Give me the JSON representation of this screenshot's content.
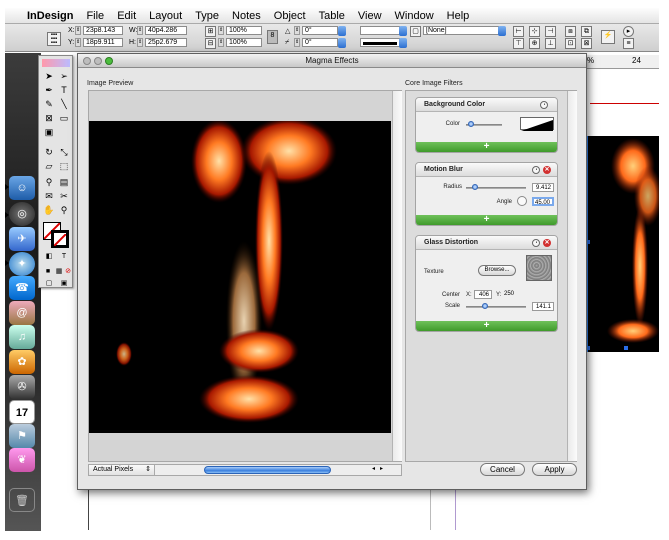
{
  "menu": {
    "app": "InDesign",
    "items": [
      "File",
      "Edit",
      "Layout",
      "Type",
      "Notes",
      "Object",
      "Table",
      "View",
      "Window",
      "Help"
    ]
  },
  "control": {
    "x": "23p8.143",
    "y": "18p9.911",
    "w": "40p4.286",
    "h": "25p2.679",
    "x_label": "X:",
    "y_label": "Y:",
    "w_label": "W:",
    "h_label": "H:",
    "scale_x": "100%",
    "scale_y": "100%",
    "rotate": "0°",
    "shear": "0°",
    "style": "[None]"
  },
  "ruler": {
    "percent": "%",
    "tick_24": "24"
  },
  "dialog": {
    "title": "Magma Effects",
    "preview_label": "Image Preview",
    "filters_label": "Core Image Filters",
    "zoom": "Actual Pixels",
    "cancel": "Cancel",
    "apply": "Apply"
  },
  "filters": [
    {
      "name": "Background Color",
      "params": [
        {
          "label": "Color"
        }
      ]
    },
    {
      "name": "Motion Blur",
      "params": [
        {
          "label": "Radius",
          "value": "9.412"
        },
        {
          "label": "Angle",
          "value": "45.00"
        }
      ]
    },
    {
      "name": "Glass Distortion",
      "texture_label": "Texture",
      "browse": "Browse...",
      "center_label": "Center",
      "center_x_label": "X:",
      "center_x": "406",
      "center_y_label": "Y:",
      "center_y": "250",
      "scale_label": "Scale",
      "scale": "141.1"
    }
  ],
  "add_label": "+",
  "dock_calendar_day": "17",
  "colors": {
    "accent_blue": "#3a7fde",
    "add_green": "#4fa83a",
    "close_red": "#d23030"
  }
}
